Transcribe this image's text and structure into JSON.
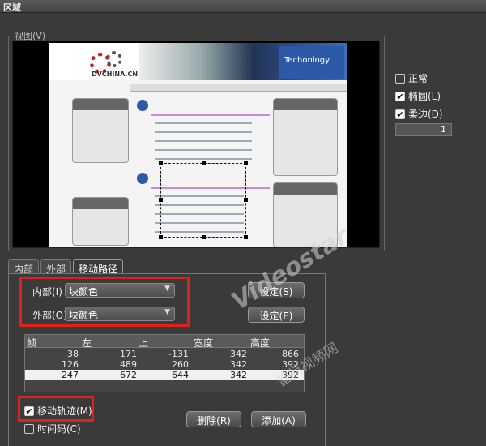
{
  "window": {
    "title": "区域"
  },
  "view": {
    "label": "视图(V)"
  },
  "preview": {
    "logo_text": "DVCHINA.CN",
    "banner_text": "Techonlogy"
  },
  "options": {
    "normal": {
      "label": "正常",
      "checked": false
    },
    "ellipse": {
      "label": "椭圆(L)",
      "checked": true
    },
    "soft_edge": {
      "label": "柔边(D)",
      "checked": true
    },
    "soft_value": "1"
  },
  "tabs": [
    {
      "label": "内部",
      "active": false
    },
    {
      "label": "外部",
      "active": false
    },
    {
      "label": "移动路径",
      "active": true
    }
  ],
  "inner": {
    "label": "内部(I)",
    "value": "块颜色",
    "button": "设定(S)"
  },
  "outer": {
    "label": "外部(O)",
    "value": "块颜色",
    "button": "设定(E)"
  },
  "table": {
    "headers": [
      "帧",
      "左",
      "上",
      "宽度",
      "高度"
    ],
    "rows": [
      [
        "38",
        "171",
        "-131",
        "342",
        "866"
      ],
      [
        "126",
        "489",
        "260",
        "342",
        "392"
      ],
      [
        "247",
        "672",
        "644",
        "342",
        "392"
      ]
    ],
    "selected_row": 2
  },
  "motion_track": {
    "label": "移动轨迹(M)",
    "checked": true
  },
  "timecode": {
    "label": "时间码(C)",
    "checked": false
  },
  "buttons": {
    "delete": "删除(R)",
    "add": "添加(A)"
  },
  "watermark": {
    "brand": "Videostar",
    "site": "雷特视频网"
  },
  "colors": {
    "highlight_red": "#e0201c",
    "panel_bg": "#3a3a3a"
  }
}
